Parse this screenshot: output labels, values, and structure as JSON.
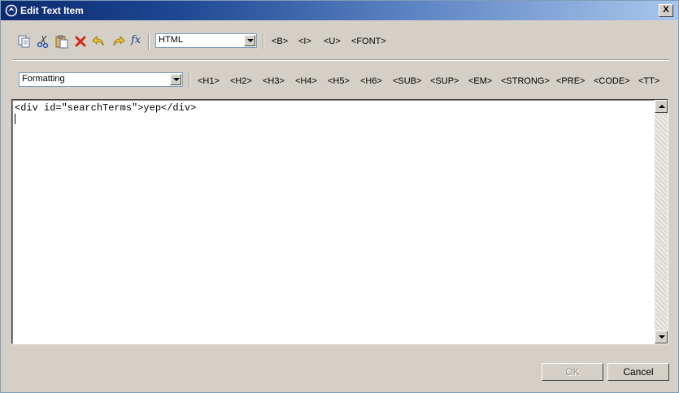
{
  "window": {
    "title": "Edit Text Item",
    "close_label": "X"
  },
  "toolbar": {
    "icons": [
      "copy-icon",
      "cut-icon",
      "paste-icon",
      "delete-icon",
      "undo-icon",
      "redo-icon",
      "function-icon"
    ],
    "function_label": "fx",
    "mode_select": {
      "value": "HTML"
    },
    "tags": [
      "<B>",
      "<I>",
      "<U>",
      "<FONT>"
    ]
  },
  "format_bar": {
    "style_select": {
      "value": "Formatting"
    },
    "tags": [
      "<H1>",
      "<H2>",
      "<H3>",
      "<H4>",
      "<H5>",
      "<H6>",
      "<SUB>",
      "<SUP>",
      "<EM>",
      "<STRONG>",
      "<PRE>",
      "<CODE>",
      "<TT>"
    ]
  },
  "editor": {
    "content": "<div id=\"searchTerms\">yep</div>"
  },
  "buttons": {
    "ok": "OK",
    "cancel": "Cancel"
  },
  "colors": {
    "title_start": "#0c2a6e",
    "title_end": "#a9c6ec",
    "face": "#d4d0c8"
  }
}
